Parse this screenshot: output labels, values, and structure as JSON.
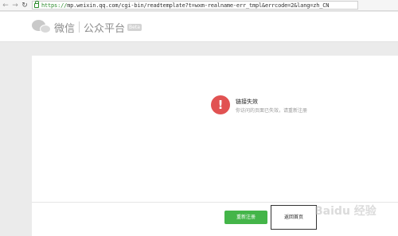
{
  "browser": {
    "url_scheme": "https://",
    "url_rest": "mp.weixin.qq.com/cgi-bin/readtemplate?t=wxm-realname-err_tmpl&errcode=2&lang=zh_CN"
  },
  "header": {
    "logo_text": "微信",
    "platform_text": "公众平台",
    "badge": "Beta"
  },
  "message": {
    "title": "链接失效",
    "description": "你访问的页面已失效，请重新注册"
  },
  "buttons": {
    "primary_label": "重新注册",
    "secondary_label": "返回首页"
  },
  "watermark": "Baidu 经验",
  "colors": {
    "error_icon": "#e15252",
    "primary_button": "#44b549",
    "page_background": "#ebebeb"
  }
}
